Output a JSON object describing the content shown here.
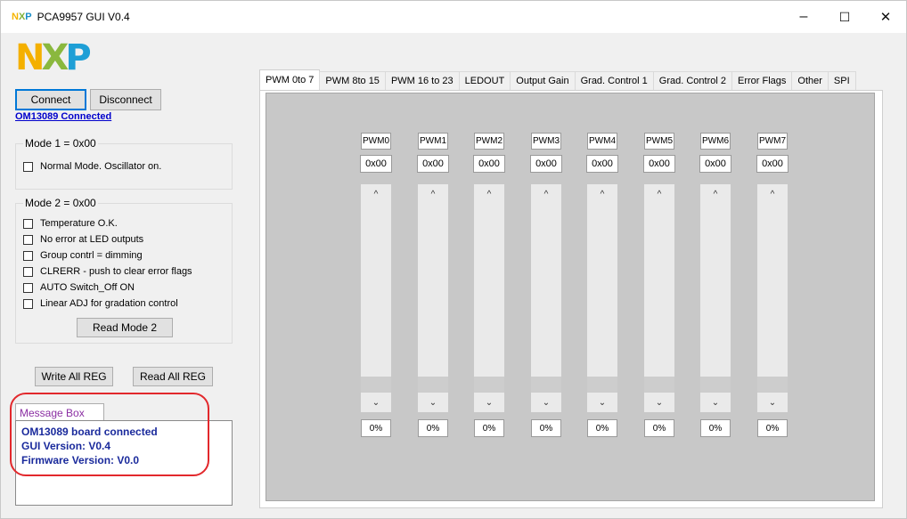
{
  "window": {
    "title": "PCA9957 GUI V0.4",
    "icon_letters": [
      "N",
      "X",
      "P"
    ],
    "controls": {
      "minimize": "–",
      "maximize": "☐",
      "close": "✕"
    }
  },
  "logo": {
    "letters": [
      "N",
      "X",
      "P"
    ]
  },
  "connection": {
    "connect_label": "Connect",
    "disconnect_label": "Disconnect",
    "status": "OM13089 Connected"
  },
  "mode1": {
    "title": "Mode 1 = 0x00",
    "options": [
      {
        "label": "Normal Mode. Oscillator on.",
        "checked": false
      }
    ]
  },
  "mode2": {
    "title": "Mode 2 = 0x00",
    "options": [
      {
        "label": "Temperature O.K.",
        "checked": false
      },
      {
        "label": "No error at LED outputs",
        "checked": false
      },
      {
        "label": "Group contrl = dimming",
        "checked": false
      },
      {
        "label": "CLRERR - push to clear error flags",
        "checked": false
      },
      {
        "label": "AUTO Switch_Off ON",
        "checked": false
      },
      {
        "label": "Linear ADJ for gradation control",
        "checked": false
      }
    ],
    "read_button": "Read Mode 2"
  },
  "registers": {
    "write_all": "Write All REG",
    "read_all": "Read All REG"
  },
  "message_box": {
    "tab_label": "Message Box",
    "lines": [
      "OM13089 board connected",
      "GUI Version: V0.4",
      "Firmware Version: V0.0"
    ]
  },
  "tabs": [
    {
      "label": "PWM 0to 7",
      "active": true
    },
    {
      "label": "PWM 8to 15",
      "active": false
    },
    {
      "label": "PWM 16 to 23",
      "active": false
    },
    {
      "label": "LEDOUT",
      "active": false
    },
    {
      "label": "Output Gain",
      "active": false
    },
    {
      "label": "Grad. Control 1",
      "active": false
    },
    {
      "label": "Grad. Control 2",
      "active": false
    },
    {
      "label": "Error Flags",
      "active": false
    },
    {
      "label": "Other",
      "active": false
    },
    {
      "label": "SPI",
      "active": false
    }
  ],
  "pwm_channels": [
    {
      "label": "PWM0",
      "value": "0x00",
      "percent": "0%",
      "level": 0
    },
    {
      "label": "PWM1",
      "value": "0x00",
      "percent": "0%",
      "level": 0
    },
    {
      "label": "PWM2",
      "value": "0x00",
      "percent": "0%",
      "level": 0
    },
    {
      "label": "PWM3",
      "value": "0x00",
      "percent": "0%",
      "level": 0
    },
    {
      "label": "PWM4",
      "value": "0x00",
      "percent": "0%",
      "level": 0
    },
    {
      "label": "PWM5",
      "value": "0x00",
      "percent": "0%",
      "level": 0
    },
    {
      "label": "PWM6",
      "value": "0x00",
      "percent": "0%",
      "level": 0
    },
    {
      "label": "PWM7",
      "value": "0x00",
      "percent": "0%",
      "level": 0
    }
  ],
  "icons": {
    "slider_up": "chevron-up-icon",
    "slider_down": "chevron-down-icon"
  },
  "colors": {
    "link": "#0000cc",
    "message_text": "#1a2a9c",
    "message_tab": "#8b2fa3",
    "highlight": "#e2282c"
  }
}
